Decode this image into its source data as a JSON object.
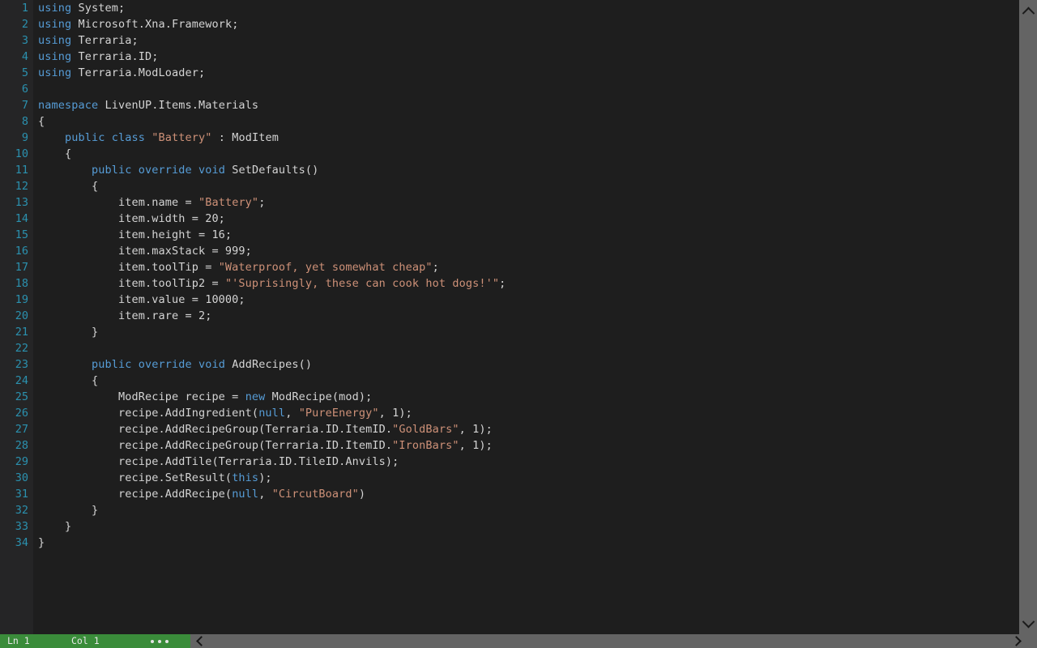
{
  "editor": {
    "language": "csharp",
    "colors": {
      "background": "#1e1e1e",
      "gutter_background": "#252526",
      "line_number": "#2b91af",
      "plain_text": "#d4d4d4",
      "keyword": "#569cd6",
      "string": "#ce9178",
      "scrollbar": "#646464",
      "status_accent": "#3a8c3a"
    },
    "lines": [
      {
        "n": "1",
        "tokens": [
          {
            "t": "using",
            "c": "kw"
          },
          {
            "t": " System;",
            "c": "pln"
          }
        ]
      },
      {
        "n": "2",
        "tokens": [
          {
            "t": "using",
            "c": "kw"
          },
          {
            "t": " Microsoft.Xna.Framework;",
            "c": "pln"
          }
        ]
      },
      {
        "n": "3",
        "tokens": [
          {
            "t": "using",
            "c": "kw"
          },
          {
            "t": " Terraria;",
            "c": "pln"
          }
        ]
      },
      {
        "n": "4",
        "tokens": [
          {
            "t": "using",
            "c": "kw"
          },
          {
            "t": " Terraria.ID;",
            "c": "pln"
          }
        ]
      },
      {
        "n": "5",
        "tokens": [
          {
            "t": "using",
            "c": "kw"
          },
          {
            "t": " Terraria.ModLoader;",
            "c": "pln"
          }
        ]
      },
      {
        "n": "6",
        "tokens": []
      },
      {
        "n": "7",
        "tokens": [
          {
            "t": "namespace",
            "c": "kw"
          },
          {
            "t": " LivenUP.Items.Materials",
            "c": "pln"
          }
        ]
      },
      {
        "n": "8",
        "tokens": [
          {
            "t": "{",
            "c": "pln"
          }
        ]
      },
      {
        "n": "9",
        "tokens": [
          {
            "t": "    ",
            "c": "pln"
          },
          {
            "t": "public class",
            "c": "kw"
          },
          {
            "t": " ",
            "c": "pln"
          },
          {
            "t": "\"Battery\"",
            "c": "str"
          },
          {
            "t": " : ModItem",
            "c": "pln"
          }
        ]
      },
      {
        "n": "10",
        "tokens": [
          {
            "t": "    {",
            "c": "pln"
          }
        ]
      },
      {
        "n": "11",
        "tokens": [
          {
            "t": "        ",
            "c": "pln"
          },
          {
            "t": "public override void",
            "c": "kw"
          },
          {
            "t": " SetDefaults()",
            "c": "pln"
          }
        ]
      },
      {
        "n": "12",
        "tokens": [
          {
            "t": "        {",
            "c": "pln"
          }
        ]
      },
      {
        "n": "13",
        "tokens": [
          {
            "t": "            item.name = ",
            "c": "pln"
          },
          {
            "t": "\"Battery\"",
            "c": "str"
          },
          {
            "t": ";",
            "c": "pln"
          }
        ]
      },
      {
        "n": "14",
        "tokens": [
          {
            "t": "            item.width = 20;",
            "c": "pln"
          }
        ]
      },
      {
        "n": "15",
        "tokens": [
          {
            "t": "            item.height = 16;",
            "c": "pln"
          }
        ]
      },
      {
        "n": "16",
        "tokens": [
          {
            "t": "            item.maxStack = 999;",
            "c": "pln"
          }
        ]
      },
      {
        "n": "17",
        "tokens": [
          {
            "t": "            item.toolTip = ",
            "c": "pln"
          },
          {
            "t": "\"Waterproof, yet somewhat cheap\"",
            "c": "str"
          },
          {
            "t": ";",
            "c": "pln"
          }
        ]
      },
      {
        "n": "18",
        "tokens": [
          {
            "t": "            item.toolTip2 = ",
            "c": "pln"
          },
          {
            "t": "\"'Suprisingly, these can cook hot dogs!'\"",
            "c": "str"
          },
          {
            "t": ";",
            "c": "pln"
          }
        ]
      },
      {
        "n": "19",
        "tokens": [
          {
            "t": "            item.value = 10000;",
            "c": "pln"
          }
        ]
      },
      {
        "n": "20",
        "tokens": [
          {
            "t": "            item.rare = 2;",
            "c": "pln"
          }
        ]
      },
      {
        "n": "21",
        "tokens": [
          {
            "t": "        }",
            "c": "pln"
          }
        ]
      },
      {
        "n": "22",
        "tokens": []
      },
      {
        "n": "23",
        "tokens": [
          {
            "t": "        ",
            "c": "pln"
          },
          {
            "t": "public override void",
            "c": "kw"
          },
          {
            "t": " AddRecipes()",
            "c": "pln"
          }
        ]
      },
      {
        "n": "24",
        "tokens": [
          {
            "t": "        {",
            "c": "pln"
          }
        ]
      },
      {
        "n": "25",
        "tokens": [
          {
            "t": "            ModRecipe recipe = ",
            "c": "pln"
          },
          {
            "t": "new",
            "c": "kw"
          },
          {
            "t": " ModRecipe(mod);",
            "c": "pln"
          }
        ]
      },
      {
        "n": "26",
        "tokens": [
          {
            "t": "            recipe.AddIngredient(",
            "c": "pln"
          },
          {
            "t": "null",
            "c": "kw"
          },
          {
            "t": ", ",
            "c": "pln"
          },
          {
            "t": "\"PureEnergy\"",
            "c": "str"
          },
          {
            "t": ", 1);",
            "c": "pln"
          }
        ]
      },
      {
        "n": "27",
        "tokens": [
          {
            "t": "            recipe.AddRecipeGroup(Terraria.ID.ItemID.",
            "c": "pln"
          },
          {
            "t": "\"GoldBars\"",
            "c": "str"
          },
          {
            "t": ", 1);",
            "c": "pln"
          }
        ]
      },
      {
        "n": "28",
        "tokens": [
          {
            "t": "            recipe.AddRecipeGroup(Terraria.ID.ItemID.",
            "c": "pln"
          },
          {
            "t": "\"IronBars\"",
            "c": "str"
          },
          {
            "t": ", 1);",
            "c": "pln"
          }
        ]
      },
      {
        "n": "29",
        "tokens": [
          {
            "t": "            recipe.AddTile(Terraria.ID.TileID.Anvils);",
            "c": "pln"
          }
        ]
      },
      {
        "n": "30",
        "tokens": [
          {
            "t": "            recipe.SetResult(",
            "c": "pln"
          },
          {
            "t": "this",
            "c": "kw"
          },
          {
            "t": ");",
            "c": "pln"
          }
        ]
      },
      {
        "n": "31",
        "tokens": [
          {
            "t": "            recipe.AddRecipe(",
            "c": "pln"
          },
          {
            "t": "null",
            "c": "kw"
          },
          {
            "t": ", ",
            "c": "pln"
          },
          {
            "t": "\"CircutBoard\"",
            "c": "str"
          },
          {
            "t": ")",
            "c": "pln"
          }
        ]
      },
      {
        "n": "32",
        "tokens": [
          {
            "t": "        }",
            "c": "pln"
          }
        ]
      },
      {
        "n": "33",
        "tokens": [
          {
            "t": "    }",
            "c": "pln"
          }
        ]
      },
      {
        "n": "34",
        "tokens": [
          {
            "t": "}",
            "c": "pln"
          }
        ]
      }
    ]
  },
  "statusbar": {
    "line_label": "Ln 1",
    "column_label": "Col 1",
    "more_icon": "ellipsis-icon",
    "prev_icon": "chevron-left-icon",
    "next_icon": "chevron-right-icon"
  },
  "scrollbar": {
    "up_icon": "chevron-up-icon",
    "down_icon": "chevron-down-icon"
  }
}
